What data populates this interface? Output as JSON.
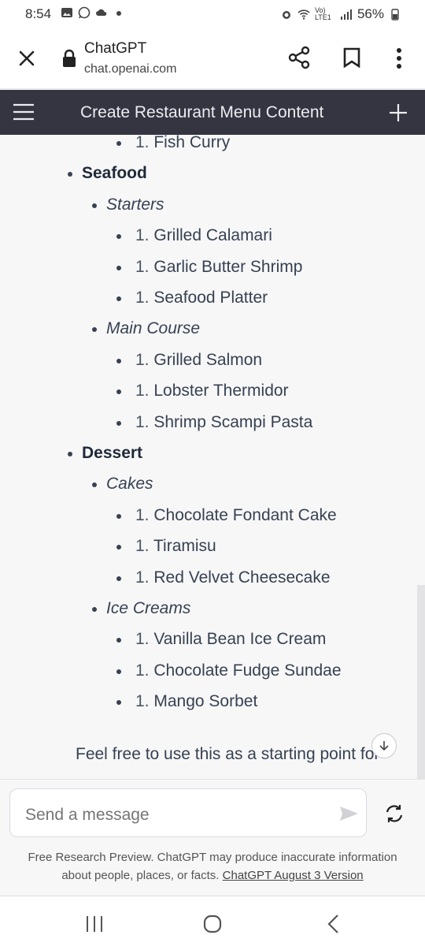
{
  "status": {
    "time": "8:54",
    "signal": "Vo) LTE1",
    "battery": "56%"
  },
  "browser": {
    "site_title": "ChatGPT",
    "url": "chat.openai.com"
  },
  "chat": {
    "title": "Create Restaurant Menu Content"
  },
  "menu": [
    {
      "kind": "item",
      "num": "1.",
      "text": "Fish Curry"
    },
    {
      "kind": "category",
      "text": "Seafood"
    },
    {
      "kind": "subcategory",
      "text": "Starters"
    },
    {
      "kind": "item",
      "num": "1.",
      "text": "Grilled Calamari"
    },
    {
      "kind": "item",
      "num": "1.",
      "text": "Garlic Butter Shrimp"
    },
    {
      "kind": "item",
      "num": "1.",
      "text": "Seafood Platter"
    },
    {
      "kind": "subcategory",
      "text": "Main Course"
    },
    {
      "kind": "item",
      "num": "1.",
      "text": "Grilled Salmon"
    },
    {
      "kind": "item",
      "num": "1.",
      "text": "Lobster Thermidor"
    },
    {
      "kind": "item",
      "num": "1.",
      "text": "Shrimp Scampi Pasta"
    },
    {
      "kind": "category",
      "text": "Dessert"
    },
    {
      "kind": "subcategory",
      "text": "Cakes"
    },
    {
      "kind": "item",
      "num": "1.",
      "text": "Chocolate Fondant Cake"
    },
    {
      "kind": "item",
      "num": "1.",
      "text": "Tiramisu"
    },
    {
      "kind": "item",
      "num": "1.",
      "text": "Red Velvet Cheesecake"
    },
    {
      "kind": "subcategory",
      "text": "Ice Creams"
    },
    {
      "kind": "item",
      "num": "1.",
      "text": "Vanilla Bean Ice Cream"
    },
    {
      "kind": "item",
      "num": "1.",
      "text": "Chocolate Fudge Sundae"
    },
    {
      "kind": "item",
      "num": "1.",
      "text": "Mango Sorbet"
    }
  ],
  "closing_text": "Feel free to use this as a starting point for",
  "input": {
    "placeholder": "Send a message"
  },
  "disclaimer": {
    "line1": "Free Research Preview. ChatGPT may produce inaccurate information",
    "line2_prefix": "about people, places, or facts. ",
    "version_link": "ChatGPT August 3 Version"
  }
}
